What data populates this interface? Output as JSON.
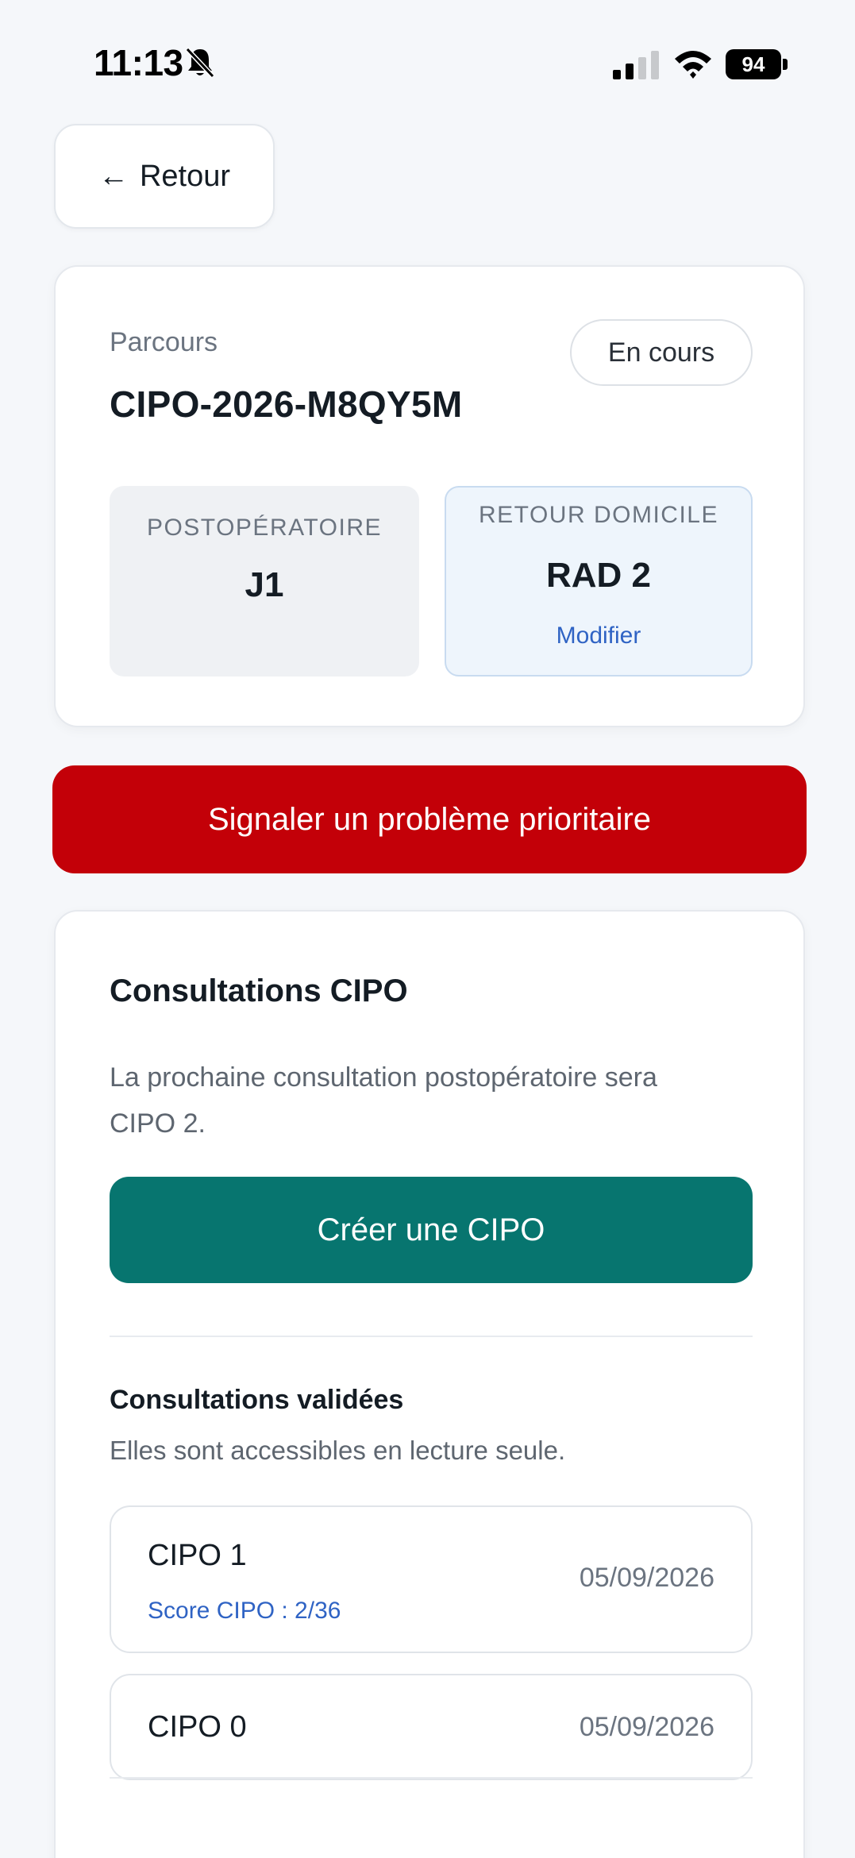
{
  "status_bar": {
    "time": "11:13",
    "battery": "94",
    "icons": [
      "bell-slash-icon",
      "signal-icon",
      "wifi-icon",
      "battery-icon"
    ]
  },
  "back_button": {
    "label": "Retour",
    "icon": "arrow-left-icon"
  },
  "parcours": {
    "label": "Parcours",
    "id": "CIPO-2026-M8QY5M",
    "status": "En cours",
    "postop": {
      "label": "POSTOPÉRATOIRE",
      "value": "J1"
    },
    "retour": {
      "label": "RETOUR DOMICILE",
      "value": "RAD 2",
      "action": "Modifier"
    }
  },
  "priority_button": {
    "label": "Signaler un problème prioritaire"
  },
  "consultations": {
    "title": "Consultations CIPO",
    "description": "La prochaine consultation postopératoire sera CIPO 2.",
    "create_label": "Créer une CIPO",
    "validated": {
      "title": "Consultations validées",
      "description": "Elles sont accessibles en lecture seule.",
      "items": [
        {
          "name": "CIPO 1",
          "score": "Score CIPO : 2/36",
          "date": "05/09/2026"
        },
        {
          "name": "CIPO 0",
          "date": "05/09/2026"
        }
      ]
    }
  },
  "colors": {
    "background": "#f5f7fa",
    "priority": "#c30008",
    "primary": "#07756f",
    "link": "#2f63c4"
  }
}
